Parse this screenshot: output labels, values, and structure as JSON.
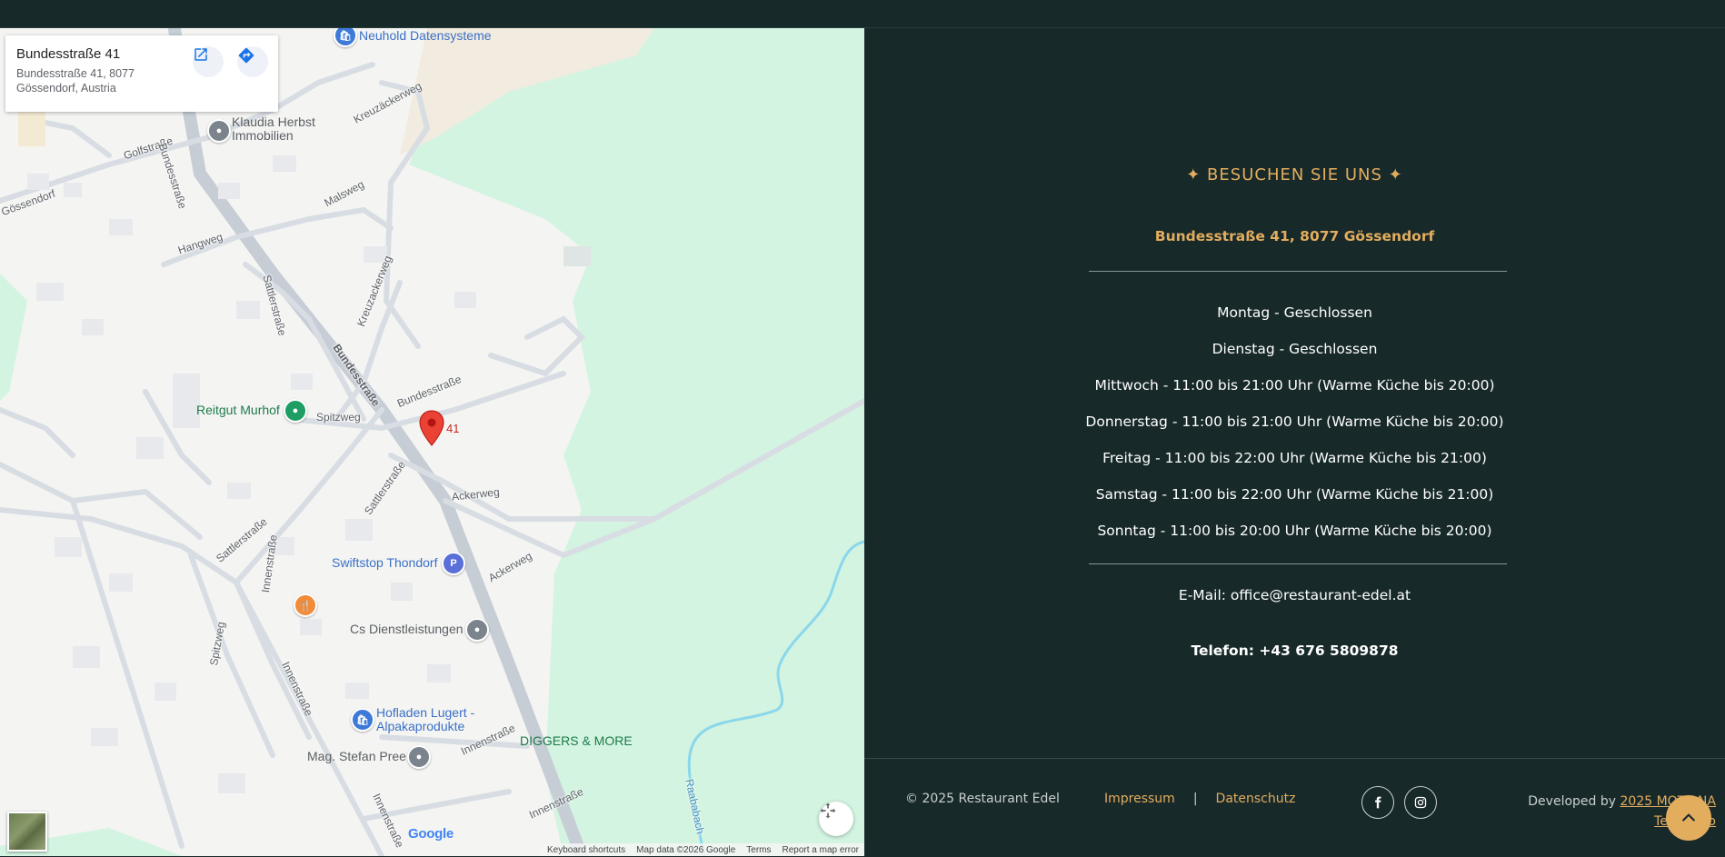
{
  "map": {
    "card": {
      "title": "Bundesstraße 41",
      "address": "Bundesstraße 41, 8077 Gössendorf, Austria"
    },
    "marker_label": "41",
    "streets": [
      "Golfstraße",
      "Bundesstraße",
      "Kreuzäckerweg",
      "Malsweg",
      "Hangweg",
      "Sattlerstraße",
      "Kreuzackerweg",
      "Bundesstraße",
      "Bundesstraße",
      "Spitzweg",
      "Sattlerstraße",
      "Ackerweg",
      "Sattlerstraße",
      "Innenstraße",
      "Ackerweg",
      "Spitzweg",
      "Innenstraße",
      "Innenstraße",
      "Innenstraße",
      "Innenstraße",
      "Raababach",
      "Gössendorf"
    ],
    "pois": {
      "neuhold": "Neuhold Datensysteme",
      "klaudia": "Klaudia Herbst Immobilien",
      "reitgut": "Reitgut Murhof",
      "swiftstop": "Swiftstop Thondorf",
      "cs": "Cs Dienstleistungen",
      "hofladen": "Hofladen Lugert - Alpakaprodukte",
      "stefan": "Mag. Stefan Pree",
      "diggers": "DIGGERS & MORE"
    },
    "google": "Google",
    "attribution": [
      "Keyboard shortcuts",
      "Map data ©2026 Google",
      "Terms",
      "Report a map error"
    ]
  },
  "visit": {
    "heading": "✦ BESUCHEN SIE UNS ✦",
    "address": "Bundesstraße 41, 8077 Gössendorf",
    "hours": [
      "Montag - Geschlossen",
      "Dienstag - Geschlossen",
      "Mittwoch - 11:00 bis 21:00 Uhr (Warme Küche bis 20:00)",
      "Donnerstag - 11:00 bis 21:00 Uhr (Warme Küche bis 20:00)",
      "Freitag - 11:00 bis 22:00 Uhr (Warme Küche bis 21:00)",
      "Samstag - 11:00 bis 22:00 Uhr (Warme Küche bis 21:00)",
      "Sonntag - 11:00 bis 20:00 Uhr (Warme Küche bis 20:00)"
    ],
    "email": "E-Mail: office@restaurant-edel.at",
    "phone": "Telefon: +43 676 5809878"
  },
  "footer": {
    "copyright": "© 2025 Restaurant Edel",
    "impressum": "Impressum",
    "separator": "|",
    "datenschutz": "Datenschutz",
    "dev_prefix": "Developed by",
    "dev_link": "2025 MOTIANA",
    "dev_link2": "Team Info"
  },
  "icons": [
    "open-external-icon",
    "directions-icon",
    "map-pin-icon",
    "fullscreen-icon",
    "facebook-icon",
    "instagram-icon",
    "arrow-up-icon"
  ],
  "colors": {
    "background": "#18292a",
    "accent": "#e3ad5e",
    "text": "#ffffff"
  }
}
